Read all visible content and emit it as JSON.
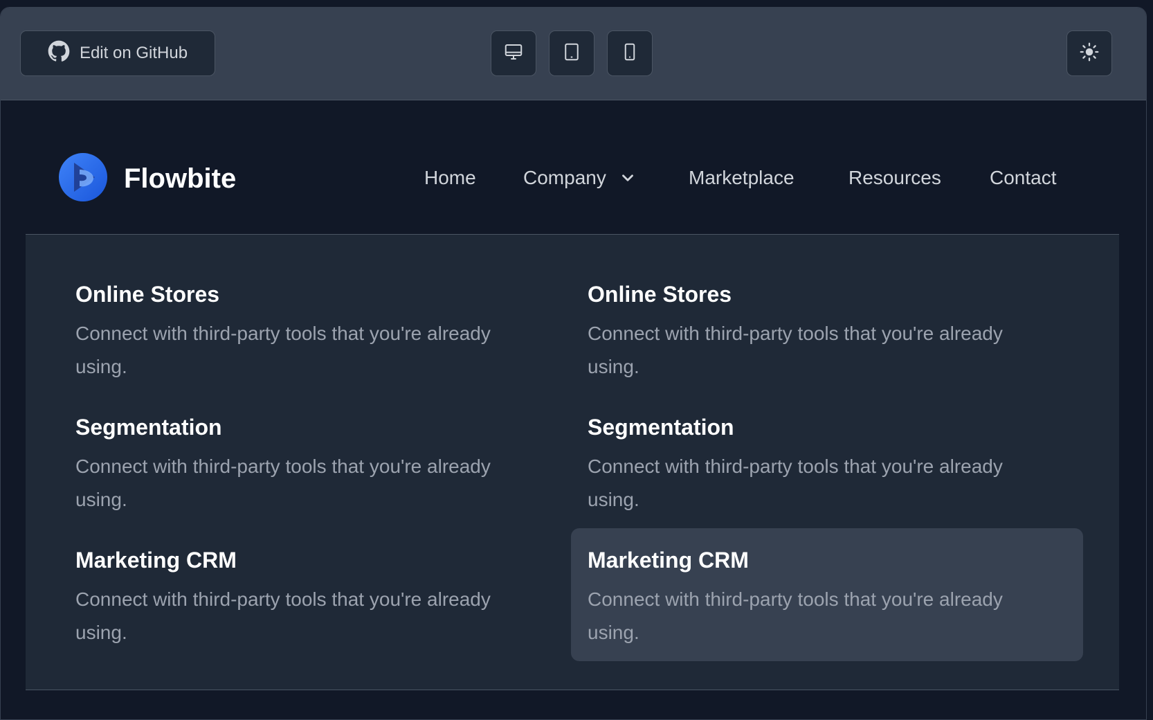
{
  "toolbar": {
    "github_label": "Edit on GitHub",
    "view_buttons": [
      {
        "icon": "desktop-icon"
      },
      {
        "icon": "tablet-icon"
      },
      {
        "icon": "mobile-icon"
      }
    ],
    "theme_icon": "sun-icon"
  },
  "nav": {
    "brand": "Flowbite",
    "links": {
      "home": "Home",
      "company": "Company",
      "marketplace": "Marketplace",
      "resources": "Resources",
      "contact": "Contact"
    }
  },
  "mega_menu": {
    "items": [
      {
        "title": "Online Stores",
        "desc": "Connect with third-party tools that you're already using."
      },
      {
        "title": "Online Stores",
        "desc": "Connect with third-party tools that you're already using."
      },
      {
        "title": "Segmentation",
        "desc": "Connect with third-party tools that you're already using."
      },
      {
        "title": "Segmentation",
        "desc": "Connect with third-party tools that you're already using."
      },
      {
        "title": "Marketing CRM",
        "desc": "Connect with third-party tools that you're already using."
      },
      {
        "title": "Marketing CRM",
        "desc": "Connect with third-party tools that you're already using."
      }
    ]
  },
  "colors": {
    "page_bg": "#111827",
    "toolbar_bg": "#374151",
    "menu_bg": "#1f2937",
    "accent": "#1c64f2"
  }
}
